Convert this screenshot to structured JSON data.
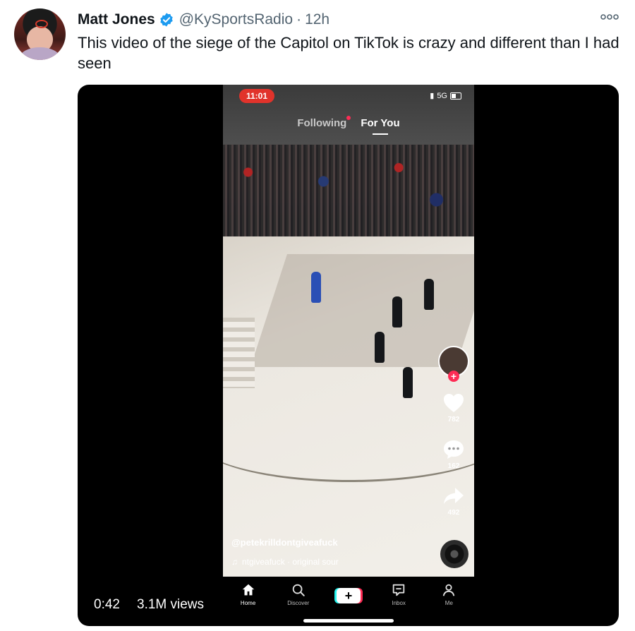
{
  "tweet": {
    "author_name": "Matt Jones",
    "handle": "@KySportsRadio",
    "separator": "·",
    "time": "12h",
    "text": "This video of the siege of the Capitol on TikTok is crazy and different than I had seen",
    "icons": {
      "verified": "verified-badge-icon",
      "more": "more-options-icon",
      "avatar": "avatar"
    }
  },
  "video": {
    "duration": "0:42",
    "views": "3.1M views"
  },
  "tiktok": {
    "status_time": "11:01",
    "network": "5G",
    "tabs": [
      {
        "label": "Following",
        "active": false
      },
      {
        "label": "For You",
        "active": true
      }
    ],
    "likes": "782",
    "comments": "162",
    "shares": "492",
    "username": "@petekrilldontgiveafuck",
    "sound_text": "ntgiveafuck · original sour",
    "nav": [
      {
        "label": "Home",
        "icon": "home-icon",
        "active": true
      },
      {
        "label": "Discover",
        "icon": "search-icon",
        "active": false
      },
      {
        "label": "+",
        "icon": "create-icon",
        "active": false
      },
      {
        "label": "Inbox",
        "icon": "inbox-icon",
        "active": false
      },
      {
        "label": "Me",
        "icon": "profile-icon",
        "active": false
      }
    ],
    "colors": {
      "accent": "#fe2c55",
      "cyan": "#25f4ee",
      "status_red": "#e1332b"
    }
  },
  "colors": {
    "verified_blue": "#1d9bf0",
    "text": "#0f1419",
    "secondary": "#536471"
  }
}
